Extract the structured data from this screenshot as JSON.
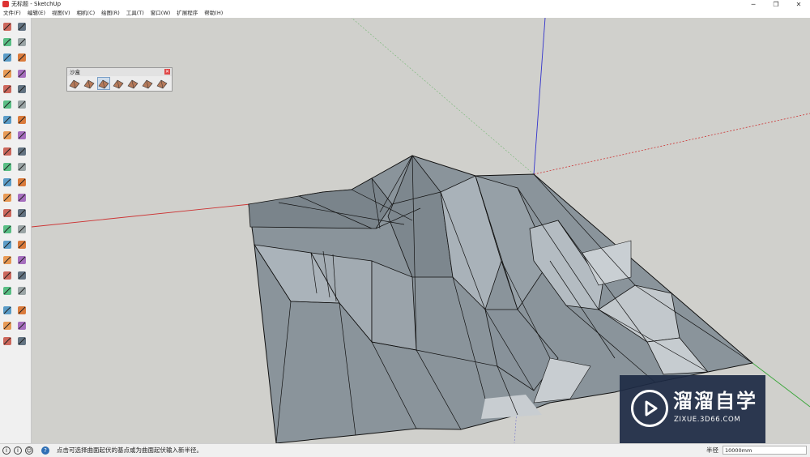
{
  "window": {
    "title": "无标题 - SketchUp",
    "controls": {
      "minimize": "─",
      "restore": "❐",
      "close": "✕"
    }
  },
  "menu": [
    "文件(F)",
    "编辑(E)",
    "视图(V)",
    "相机(C)",
    "绘图(R)",
    "工具(T)",
    "窗口(W)",
    "扩展程序",
    "帮助(H)"
  ],
  "toolbar": {
    "tools": [
      "select-icon",
      "component-icon",
      "paint-bucket-icon",
      "eraser-icon",
      "line-icon",
      "freehand-icon",
      "rectangle-icon",
      "rotated-rectangle-icon",
      "circle-icon",
      "polygon-icon",
      "arc-icon",
      "pie-icon",
      "two-point-arc-icon",
      "three-point-arc-icon",
      "move-icon",
      "push-pull-icon",
      "rotate-icon",
      "follow-me-icon",
      "scale-icon",
      "offset-icon",
      "tape-measure-icon",
      "dimension-icon",
      "protractor-icon",
      "text-icon",
      "axes-icon",
      "3d-text-icon",
      "orbit-icon",
      "pan-icon",
      "zoom-icon",
      "zoom-window-icon",
      "zoom-extents-icon",
      "previous-view-icon",
      "position-camera-icon",
      "look-around-icon",
      "walk-icon",
      "section-plane-icon",
      "warehouse-icon",
      "extension-warehouse-icon",
      "layout-icon",
      "style-builder-icon",
      "house-icon",
      "solid-tools-icon"
    ]
  },
  "sandbox_panel": {
    "title": "沙盒",
    "close": "✕",
    "tools": [
      "from-contours-icon",
      "from-scratch-icon",
      "smoove-icon",
      "stamp-icon",
      "drape-icon",
      "add-detail-icon",
      "flip-edge-icon"
    ]
  },
  "status": {
    "message": "点击可选择曲面起伏的基点或为曲面起伏输入新半径。",
    "icons": [
      "geo-location-icon",
      "credits-icon",
      "user-icon",
      "help-icon"
    ],
    "vcb_label": "半径",
    "vcb_value": "10000mm"
  },
  "watermark": {
    "main": "溜溜自学",
    "sub": "ZIXUE.3D66.COM"
  },
  "colors": {
    "viewport_bg": "#d0d0cc",
    "terrain_face": "#8a949b",
    "terrain_light": "#aab3ba",
    "terrain_edge": "#111111",
    "axis_red": "#cc3333",
    "axis_green": "#3aa63a",
    "axis_blue": "#3333cc",
    "watermark_bg": "#1e2b45"
  }
}
